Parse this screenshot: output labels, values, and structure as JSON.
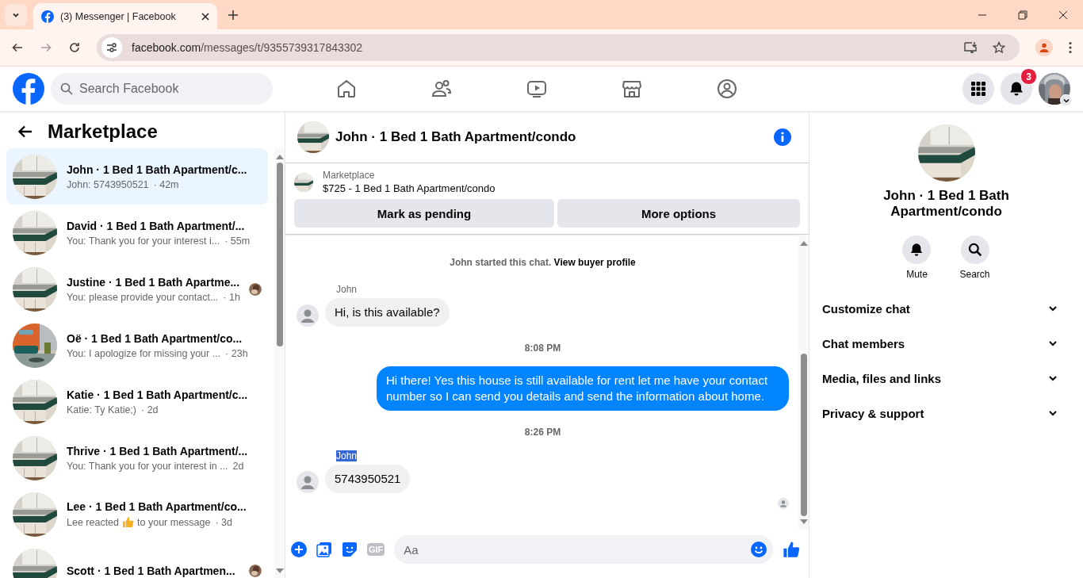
{
  "browser": {
    "tab_title": "(3) Messenger | Facebook",
    "url_host": "facebook.com",
    "url_path": "/messages/t/9355739317843302"
  },
  "topbar": {
    "search_placeholder": "Search Facebook",
    "notification_count": "3"
  },
  "sidebar": {
    "title": "Marketplace",
    "items": [
      {
        "name": "John · 1 Bed 1 Bath Apartment/c...",
        "kind": "text",
        "preview": "John: 5743950521",
        "time": "· 42m",
        "selected": true,
        "seen_avatar": false
      },
      {
        "name": "David · 1 Bed 1 Bath Apartment/...",
        "kind": "text",
        "preview": "You: Thank you for your interest i...",
        "time": "· 55m",
        "selected": false,
        "seen_avatar": false
      },
      {
        "name": "Justine · 1 Bed 1 Bath Apartme...",
        "kind": "text",
        "preview": "You: please provide your contact...",
        "time": "· 1h",
        "selected": false,
        "seen_avatar": true
      },
      {
        "name": "Oë · 1 Bed 1 Bath Apartment/co...",
        "kind": "text",
        "preview": "You: I apologize for missing your ...",
        "time": "· 23h",
        "selected": false,
        "seen_avatar": false
      },
      {
        "name": "Katie · 1 Bed 1 Bath Apartment/c...",
        "kind": "text",
        "preview": "Katie: Ty Katie;)",
        "time": "· 2d",
        "selected": false,
        "seen_avatar": false
      },
      {
        "name": "Thrive · 1 Bed 1 Bath Apartment/...",
        "kind": "text",
        "preview": "You: Thank you for your interest in ...",
        "time": "2d",
        "selected": false,
        "seen_avatar": false
      },
      {
        "name": "Lee · 1 Bed 1 Bath Apartment/co...",
        "kind": "reaction",
        "preview": "Lee reacted",
        "preview_after": "to your message",
        "time": "· 3d",
        "selected": false,
        "seen_avatar": false
      },
      {
        "name": "Scott · 1 Bed 1 Bath Apartmen...",
        "kind": "text",
        "selected": false,
        "seen_avatar": true
      }
    ]
  },
  "chat": {
    "title": "John · 1 Bed 1 Bath Apartment/condo",
    "listing": {
      "label": "Marketplace",
      "title": "$725 - 1 Bed 1 Bath Apartment/condo"
    },
    "buttons": [
      "Mark as pending",
      "More options"
    ],
    "messages": [
      {
        "kind": "system",
        "text": "John started this chat.",
        "link": "View buyer profile"
      },
      {
        "kind": "incoming",
        "sender": "John",
        "sender_selected": false,
        "text": "Hi, is this available?"
      },
      {
        "kind": "timestamp",
        "text": "8:08 PM"
      },
      {
        "kind": "outgoing",
        "text": "Hi there! Yes this house is still available for rent let me have your contact number so I can send you details and send the information about home."
      },
      {
        "kind": "timestamp",
        "text": "8:26 PM"
      },
      {
        "kind": "incoming",
        "sender": "John",
        "sender_selected": true,
        "text": "5743950521"
      }
    ],
    "composer": {
      "gif_label": "GIF",
      "placeholder": "Aa"
    }
  },
  "details": {
    "title": "John · 1 Bed 1 Bath Apartment/condo",
    "actions": [
      "Mute",
      "Search"
    ],
    "sections": [
      "Customize chat",
      "Chat members",
      "Media, files and links",
      "Privacy & support"
    ]
  }
}
